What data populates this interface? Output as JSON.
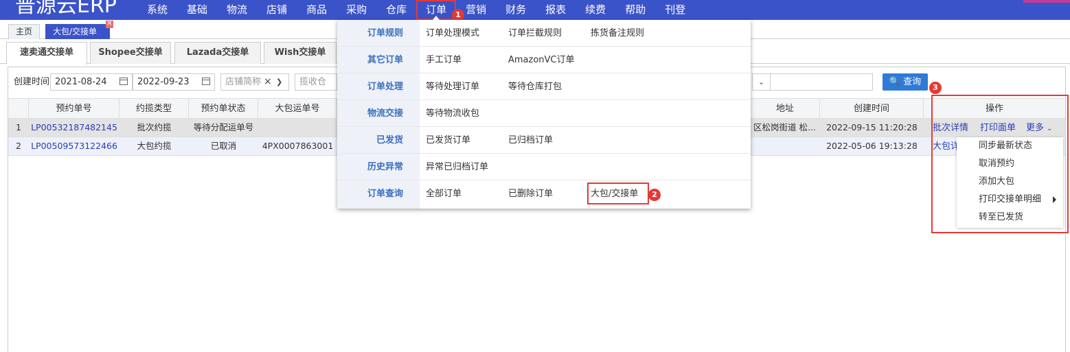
{
  "app": {
    "logo": "普源云ERP"
  },
  "nav": {
    "items": [
      "系统",
      "基础",
      "物流",
      "店铺",
      "商品",
      "采购",
      "仓库",
      "订单",
      "营销",
      "财务",
      "报表",
      "续费",
      "帮助",
      "刊登"
    ],
    "active": "订单"
  },
  "page_tabs": [
    {
      "label": "主页"
    },
    {
      "label": "大包/交接单",
      "close": "✕"
    }
  ],
  "sub_tabs": [
    "速卖通交接单",
    "Shopee交接单",
    "Lazada交接单",
    "Wish交接单"
  ],
  "filters": {
    "created_label": "创建时间",
    "date_from": "2021-08-24",
    "date_to": "2022-09-23",
    "shop_placeholder": "店铺简称",
    "warehouse_placeholder": "揽收仓",
    "query_button": "查询"
  },
  "table": {
    "columns": [
      "预约单号",
      "约揽类型",
      "预约单状态",
      "大包运单号",
      "地址",
      "创建时间",
      "操作"
    ],
    "rows": [
      {
        "index": "1",
        "booking_no": "LP00532187482145",
        "type": "批次约揽",
        "status": "等待分配运单号",
        "waybill": "",
        "address": "区松岗街道 松...",
        "created": "2022-09-15 11:20:28"
      },
      {
        "index": "2",
        "booking_no": "LP00509573122466",
        "type": "大包约揽",
        "status": "已取消",
        "waybill": "4PX0007863001",
        "address": "",
        "created": "2022-05-06 19:13:28"
      }
    ]
  },
  "order_menu": {
    "rows": [
      {
        "category": "订单规则",
        "items": [
          "订单处理模式",
          "订单拦截规则",
          "拣货备注规则"
        ]
      },
      {
        "category": "其它订单",
        "items": [
          "手工订单",
          "AmazonVC订单"
        ]
      },
      {
        "category": "订单处理",
        "items": [
          "等待处理订单",
          "等待仓库打包"
        ]
      },
      {
        "category": "物流交接",
        "items": [
          "等待物流收包"
        ]
      },
      {
        "category": "已发货",
        "items": [
          "已发货订单",
          "已归档订单"
        ]
      },
      {
        "category": "历史异常",
        "items": [
          "异常已归档订单"
        ]
      },
      {
        "category": "订单查询",
        "items": [
          "全部订单",
          "已删除订单",
          "大包/交接单"
        ]
      }
    ]
  },
  "actions": {
    "row1": {
      "batch_detail": "批次详情",
      "print": "打印面单",
      "more": "更多"
    },
    "row2": {
      "detail": "大包详"
    },
    "more_menu": [
      "同步最新状态",
      "取消预约",
      "添加大包",
      "打印交接单明细",
      "转至已发货"
    ]
  },
  "badges": [
    "1",
    "2",
    "3"
  ],
  "colors": {
    "nav_bg": "#3b53c9",
    "highlight": "#e53935",
    "link": "#2a3fb3",
    "query_btn": "#2d7bd7"
  }
}
